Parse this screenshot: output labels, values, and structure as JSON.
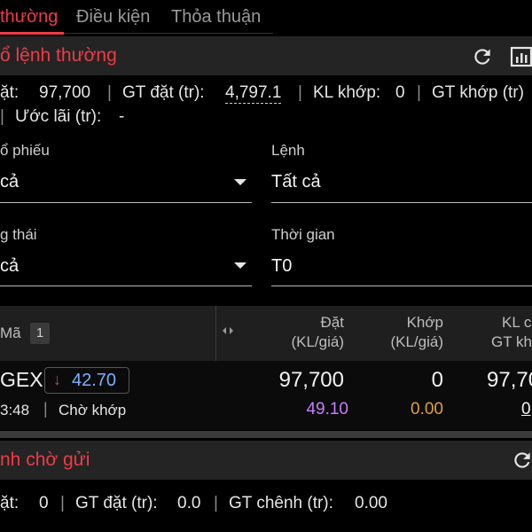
{
  "tabs": [
    {
      "label": "thường",
      "active": true
    },
    {
      "label": "Điều kiện",
      "active": false
    },
    {
      "label": "Thỏa thuận",
      "active": false
    }
  ],
  "normal_orders": {
    "title": "ổ lệnh thường",
    "summary_line1": {
      "placed_label": "ặt:",
      "placed_value": "97,700",
      "gt_placed_label": "GT đặt (tr):",
      "gt_placed_value": "4,797.1",
      "kl_matched_label": "KL khớp:",
      "kl_matched_value": "0",
      "gt_matched_label": "GT khớp (tr)"
    },
    "summary_line2": {
      "profit_label": "Ước lãi (tr):",
      "profit_value": "-"
    },
    "filters": {
      "stock_label": "ổ phiếu",
      "stock_value": "cả",
      "order_label": "Lệnh",
      "order_value": "Tất cả",
      "status_label": "g thái",
      "status_value": "cả",
      "time_label": "Thời gian",
      "time_value": "T0"
    },
    "table": {
      "headers": {
        "code": "Mã",
        "count": "1",
        "placed_l1": "Đặt",
        "placed_l2": "(KL/giá)",
        "matched_l1": "Khớp",
        "matched_l2": "(KL/giá)",
        "kl_l1": "KL c",
        "kl_l2": "GT kh"
      },
      "rows": [
        {
          "code": "GEX",
          "price_arrow": "↓",
          "price": "42.70",
          "time": "3:48",
          "status": "Chờ khớp",
          "placed_qty": "97,700",
          "placed_price": "49.10",
          "matched_qty": "0",
          "matched_price": "0.00",
          "kl_value": "97,70",
          "gt_value": "0"
        }
      ]
    }
  },
  "pending_orders": {
    "title": "nh chờ gửi",
    "summary": {
      "placed_label": "ặt:",
      "placed_value": "0",
      "gt_placed_label": "GT đặt (tr):",
      "gt_placed_value": "0.0",
      "gt_diff_label": "GT chênh (tr):",
      "gt_diff_value": "0.00"
    }
  },
  "colors": {
    "accent": "#ef3b45",
    "price_blue": "#7ab2ff",
    "placed_purple": "#c77dff",
    "matched_orange": "#e0a040"
  },
  "icons": [
    "refresh-icon",
    "chart-icon",
    "caret-down-icon",
    "arrow-down-icon",
    "resize-icon"
  ]
}
